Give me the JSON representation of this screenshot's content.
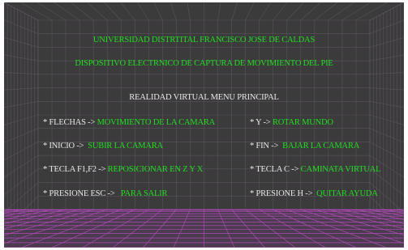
{
  "header": {
    "university": "UNIVERSIDAD DISTRTITAL FRANCISCO JOSE DE CALDAS",
    "device": "DISPOSITIVO ELECTRNICO DE CAPTURA DE MOVIMIENTO DEL PIE",
    "menu_title": "REALIDAD VIRTUAL MENU PRINCIPAL"
  },
  "menu": {
    "left": [
      {
        "key": "* FLECHAS ->",
        "action": "MOVIMIENTO DE LA CAMARA"
      },
      {
        "key": "* INICIO ->",
        "action": "SUBIR LA CAMARA"
      },
      {
        "key": "* TECLA F1,F2 ->",
        "action": "REPOSICIONAR EN Z Y X"
      },
      {
        "key": "* PRESIONE ESC ->",
        "action": "PARA SALIR"
      }
    ],
    "right": [
      {
        "key": "* Y ->",
        "action": "ROTAR MUNDO"
      },
      {
        "key": "* FIN ->",
        "action": "BAJAR LA CAMARA"
      },
      {
        "key": "* TECLA C ->",
        "action": "CAMINATA VIRTUAL"
      },
      {
        "key": "* PRESIONE H ->",
        "action": "QUITAR AYUDA"
      }
    ]
  },
  "colors": {
    "background": "#3b3b3b",
    "grid_wall": "#6a5a6e",
    "grid_floor": "#b84bc0",
    "title_text": "#22dd22",
    "key_text": "#e8e8e8",
    "action_text": "#22dd22"
  }
}
